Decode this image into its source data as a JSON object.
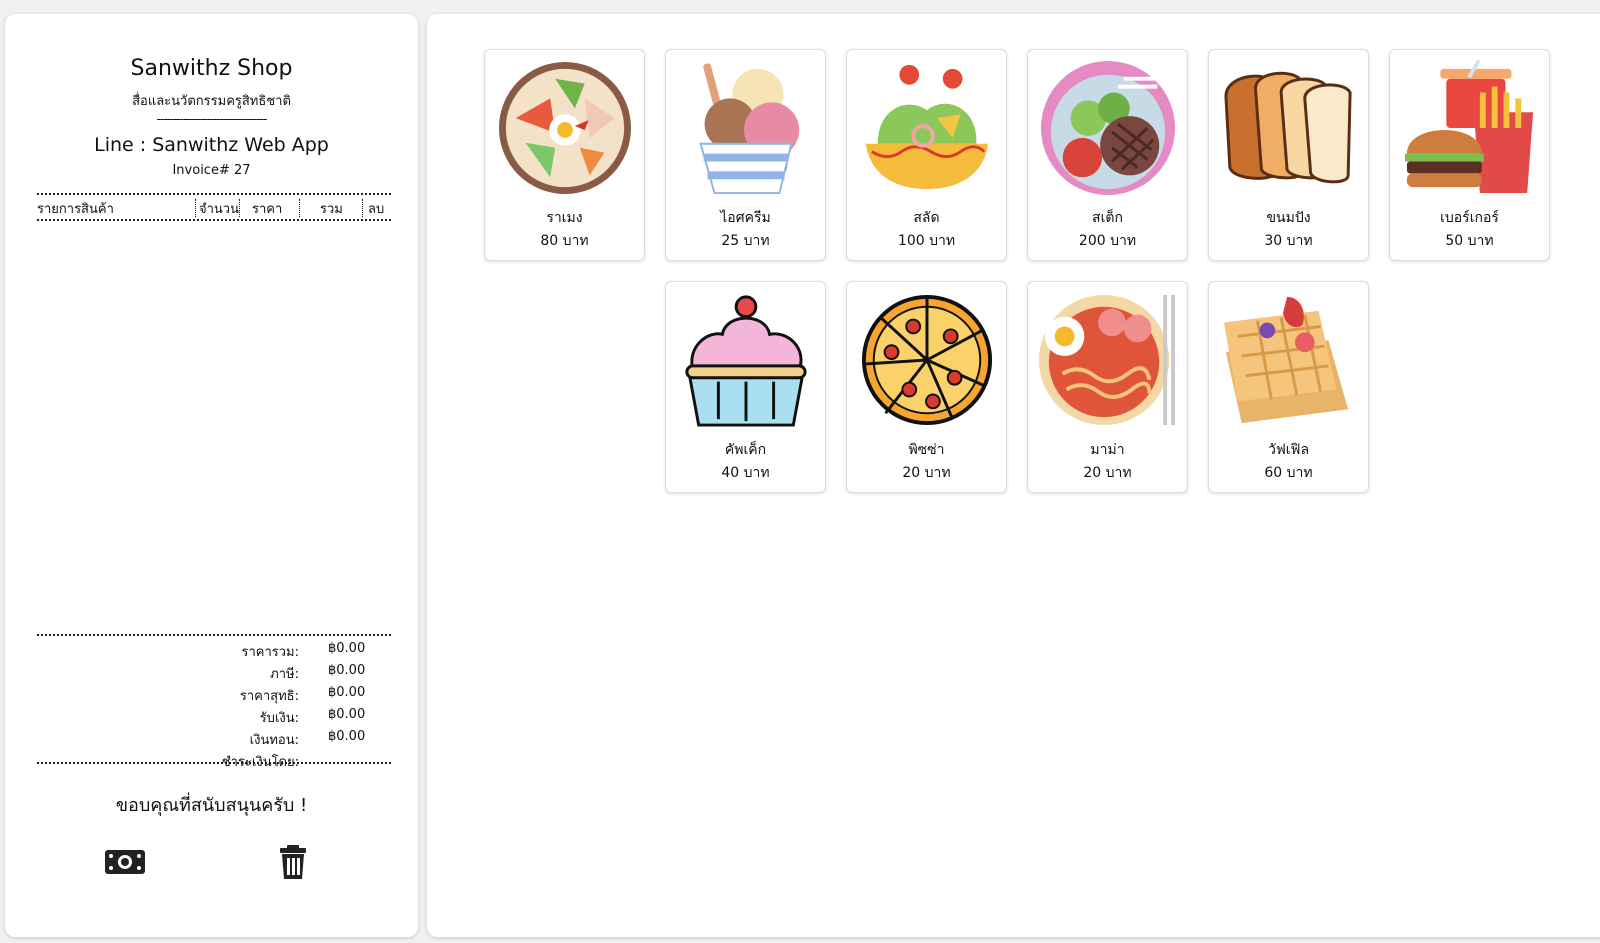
{
  "receipt": {
    "shop_name": "Sanwithz Shop",
    "subtitle": "สื่อและนวัตกรรมครูสิทธิชาติ",
    "dashes": "---------------------------------",
    "line_id": "Line : Sanwithz Web App",
    "invoice": "Invoice# 27",
    "columns": {
      "item": "รายการสินค้า",
      "qty": "จำนวน",
      "price": "ราคา",
      "total": "รวม",
      "delete": "ลบ"
    },
    "totals": [
      {
        "label": "ราคารวม:",
        "value": "฿0.00"
      },
      {
        "label": "ภาษี:",
        "value": "฿0.00"
      },
      {
        "label": "ราคาสุทธิ:",
        "value": "฿0.00"
      },
      {
        "label": "รับเงิน:",
        "value": "฿0.00"
      },
      {
        "label": "เงินทอน:",
        "value": "฿0.00"
      },
      {
        "label": "ชำระเงินโดย:",
        "value": ""
      }
    ],
    "thanks": "ขอบคุณที่สนับสนุนครับ !",
    "pay_icon": "cash-icon",
    "clear_icon": "trash-icon"
  },
  "menu": [
    {
      "name": "ราเมง",
      "price": "80 บาท",
      "icon": "ramen-bowl-icon"
    },
    {
      "name": "ไอศครีม",
      "price": "25 บาท",
      "icon": "ice-cream-icon"
    },
    {
      "name": "สลัด",
      "price": "100 บาท",
      "icon": "salad-icon"
    },
    {
      "name": "สเต็ก",
      "price": "200 บาท",
      "icon": "steak-icon"
    },
    {
      "name": "ขนมปัง",
      "price": "30 บาท",
      "icon": "bread-icon"
    },
    {
      "name": "เบอร์เกอร์",
      "price": "50 บาท",
      "icon": "burger-icon"
    },
    {
      "name": "คัพเค็ก",
      "price": "40 บาท",
      "icon": "cupcake-icon"
    },
    {
      "name": "พิซซ่า",
      "price": "20 บาท",
      "icon": "pizza-icon"
    },
    {
      "name": "มาม่า",
      "price": "20 บาท",
      "icon": "noodles-icon"
    },
    {
      "name": "วัฟเฟิล",
      "price": "60 บาท",
      "icon": "waffle-icon"
    }
  ]
}
